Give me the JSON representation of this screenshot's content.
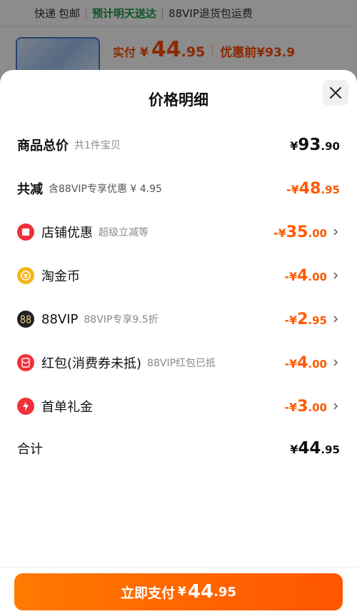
{
  "background": {
    "shipping": {
      "express": "快递",
      "free": "包邮",
      "eta": "预计明天送达",
      "return_policy": "88VIP退货包运费"
    },
    "price": {
      "paid_label": "实付",
      "currency": "¥",
      "paid_int": "44",
      "paid_dec": ".95",
      "before_label": "优惠前",
      "before_value": "¥93.9"
    }
  },
  "sheet": {
    "title": "价格明细",
    "close_icon": "close-icon"
  },
  "rows": [
    {
      "label": "商品总价",
      "sub": "共1件宝贝",
      "sign": "¥",
      "int": "93",
      "dec": ".90",
      "color": "black"
    },
    {
      "label": "共减",
      "sub": "含88VIP专享优惠 ¥ 4.95",
      "sign": "-¥",
      "int": "48",
      "dec": ".95",
      "color": "orange"
    },
    {
      "label": "店铺优惠",
      "sub": "超级立减等",
      "sign": "-¥",
      "int": "35",
      "dec": ".00",
      "color": "orange",
      "icon": "store-icon"
    },
    {
      "label": "淘金币",
      "sub": "",
      "sign": "-¥",
      "int": "4",
      "dec": ".00",
      "color": "orange",
      "icon": "coin-icon"
    },
    {
      "label": "88VIP",
      "sub": "88VIP专享9.5折",
      "sign": "-¥",
      "int": "2",
      "dec": ".95",
      "color": "orange",
      "icon": "vip88-icon"
    },
    {
      "label": "红包(消费券未抵)",
      "sub": "88VIP红包已抵",
      "sign": "-¥",
      "int": "4",
      "dec": ".00",
      "color": "orange",
      "icon": "red-envelope-icon"
    },
    {
      "label": "首单礼金",
      "sub": "",
      "sign": "-¥",
      "int": "3",
      "dec": ".00",
      "color": "orange",
      "icon": "lightning-icon"
    },
    {
      "label": "合计",
      "sub": "",
      "sign": "¥",
      "int": "44",
      "dec": ".95",
      "color": "black"
    }
  ],
  "pay_button": {
    "label": "立即支付",
    "currency": "¥",
    "int": "44",
    "dec": ".95"
  },
  "colors": {
    "accent_orange": "#ff5a00",
    "eta_green": "#1a9a4a",
    "store_red": "#f0313a",
    "coin_yellow": "#f5b51b",
    "vip_black": "#222222"
  }
}
